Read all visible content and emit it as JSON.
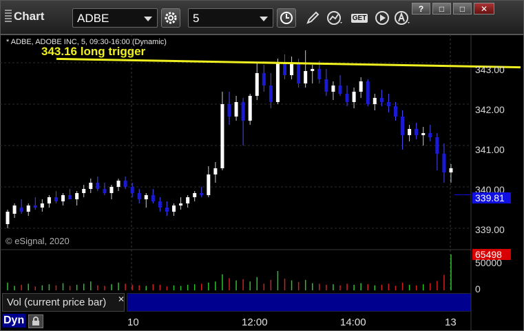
{
  "window": {
    "title": "Chart",
    "buttons": [
      "?",
      "□",
      "□",
      "✕"
    ]
  },
  "toolbar": {
    "symbol": "ADBE",
    "interval": "5",
    "icons": [
      "gear-icon",
      "clock-icon",
      "pencil-icon",
      "study-icon",
      "get-icon",
      "play-icon",
      "text-a-icon"
    ],
    "get_label": "GET"
  },
  "chart": {
    "title": "* ADBE, ADOBE INC, 5, 09:30-16:00 (Dynamic)",
    "annotation": "343.16 long trigger",
    "copyright": "© eSignal, 2020",
    "y_labels": [
      "343.00",
      "342.00",
      "341.00",
      "340.00",
      "339.00"
    ],
    "last_price": "339.81",
    "volume_last": "65498",
    "volume_labels": [
      "50000",
      "0"
    ],
    "volume_pane_label": "Vol (current price bar)",
    "dyn_label": "Dyn",
    "x_labels": [
      "10",
      "12:00",
      "14:00",
      "13"
    ],
    "colors": {
      "up_candle": "#ffffff",
      "down_candle": "#1a1ad4",
      "trendline": "#f0f020",
      "price_tag": "#1010e0",
      "volume_tag": "#d80000",
      "vol_up": "#2fc02f",
      "vol_down": "#d02020"
    }
  },
  "chart_data": {
    "type": "candlestick",
    "ylim": [
      338.6,
      343.6
    ],
    "trendline": {
      "from_bar": 16,
      "from_price": 343.16,
      "to_bar": 80,
      "to_price": 343.04
    },
    "candles": [
      [
        339.1,
        339.45,
        339.0,
        339.4
      ],
      [
        339.35,
        339.6,
        339.25,
        339.55
      ],
      [
        339.5,
        339.7,
        339.35,
        339.4
      ],
      [
        339.4,
        339.6,
        339.3,
        339.55
      ],
      [
        339.55,
        339.75,
        339.45,
        339.5
      ],
      [
        339.5,
        339.7,
        339.4,
        339.6
      ],
      [
        339.6,
        339.8,
        339.5,
        339.75
      ],
      [
        339.75,
        339.9,
        339.6,
        339.65
      ],
      [
        339.65,
        339.85,
        339.55,
        339.8
      ],
      [
        339.8,
        339.95,
        339.7,
        339.7
      ],
      [
        339.7,
        339.9,
        339.55,
        339.85
      ],
      [
        339.85,
        340.05,
        339.75,
        339.95
      ],
      [
        339.95,
        340.2,
        339.85,
        340.1
      ],
      [
        340.1,
        340.25,
        339.9,
        339.95
      ],
      [
        339.95,
        340.1,
        339.8,
        339.85
      ],
      [
        339.85,
        340.05,
        339.7,
        340.0
      ],
      [
        340.0,
        340.2,
        339.9,
        340.15
      ],
      [
        340.15,
        340.25,
        339.95,
        340.0
      ],
      [
        340.0,
        340.1,
        339.75,
        339.85
      ],
      [
        339.85,
        339.95,
        339.6,
        339.7
      ],
      [
        339.7,
        339.85,
        339.5,
        339.8
      ],
      [
        339.8,
        339.95,
        339.6,
        339.65
      ],
      [
        339.65,
        339.75,
        339.4,
        339.5
      ],
      [
        339.5,
        339.65,
        339.3,
        339.4
      ],
      [
        339.4,
        339.6,
        339.3,
        339.55
      ],
      [
        339.55,
        339.75,
        339.45,
        339.6
      ],
      [
        339.6,
        339.8,
        339.5,
        339.75
      ],
      [
        339.75,
        339.9,
        339.65,
        339.85
      ],
      [
        339.85,
        340.0,
        339.75,
        339.8
      ],
      [
        339.8,
        340.5,
        339.75,
        340.3
      ],
      [
        340.3,
        340.6,
        340.1,
        340.45
      ],
      [
        340.45,
        342.3,
        340.4,
        342.0
      ],
      [
        342.0,
        342.3,
        341.5,
        341.7
      ],
      [
        341.7,
        342.2,
        341.6,
        342.05
      ],
      [
        342.05,
        342.15,
        341.0,
        341.6
      ],
      [
        341.6,
        342.25,
        341.5,
        342.2
      ],
      [
        342.2,
        343.0,
        342.1,
        342.75
      ],
      [
        342.75,
        342.95,
        342.3,
        342.45
      ],
      [
        342.45,
        342.75,
        341.9,
        342.05
      ],
      [
        342.05,
        343.1,
        342.0,
        343.0
      ],
      [
        343.0,
        343.2,
        342.6,
        342.7
      ],
      [
        342.7,
        343.15,
        342.6,
        343.0
      ],
      [
        343.0,
        343.1,
        342.4,
        342.5
      ],
      [
        342.5,
        343.3,
        342.4,
        342.8
      ],
      [
        342.8,
        342.95,
        342.5,
        342.85
      ],
      [
        342.85,
        343.05,
        342.5,
        342.6
      ],
      [
        342.6,
        342.85,
        342.2,
        342.3
      ],
      [
        342.3,
        342.55,
        342.1,
        342.45
      ],
      [
        342.45,
        342.7,
        342.2,
        342.25
      ],
      [
        342.25,
        342.45,
        341.95,
        342.05
      ],
      [
        342.05,
        342.4,
        341.9,
        342.3
      ],
      [
        342.3,
        342.65,
        342.15,
        342.55
      ],
      [
        342.55,
        342.6,
        341.95,
        342.0
      ],
      [
        342.0,
        342.25,
        341.85,
        342.15
      ],
      [
        342.15,
        342.35,
        341.95,
        342.05
      ],
      [
        342.05,
        342.25,
        341.8,
        341.95
      ],
      [
        341.95,
        342.05,
        341.6,
        341.7
      ],
      [
        341.7,
        341.85,
        340.9,
        341.25
      ],
      [
        341.25,
        341.5,
        341.1,
        341.4
      ],
      [
        341.4,
        341.55,
        341.15,
        341.25
      ],
      [
        341.25,
        341.45,
        341.0,
        341.3
      ],
      [
        341.3,
        341.5,
        341.1,
        341.2
      ],
      [
        341.2,
        341.3,
        340.4,
        340.8
      ],
      [
        340.8,
        341.05,
        340.1,
        340.35
      ],
      [
        340.35,
        340.55,
        340.1,
        340.45
      ]
    ],
    "volumes": [
      14,
      8,
      10,
      12,
      7,
      9,
      11,
      9,
      13,
      8,
      10,
      12,
      16,
      9,
      8,
      11,
      14,
      12,
      10,
      9,
      8,
      11,
      10,
      7,
      9,
      8,
      10,
      11,
      12,
      14,
      16,
      29,
      22,
      18,
      20,
      16,
      24,
      12,
      19,
      35,
      21,
      18,
      15,
      19,
      13,
      12,
      10,
      11,
      9,
      12,
      10,
      13,
      11,
      9,
      10,
      12,
      8,
      14,
      10,
      9,
      11,
      13,
      17,
      28,
      65
    ]
  }
}
